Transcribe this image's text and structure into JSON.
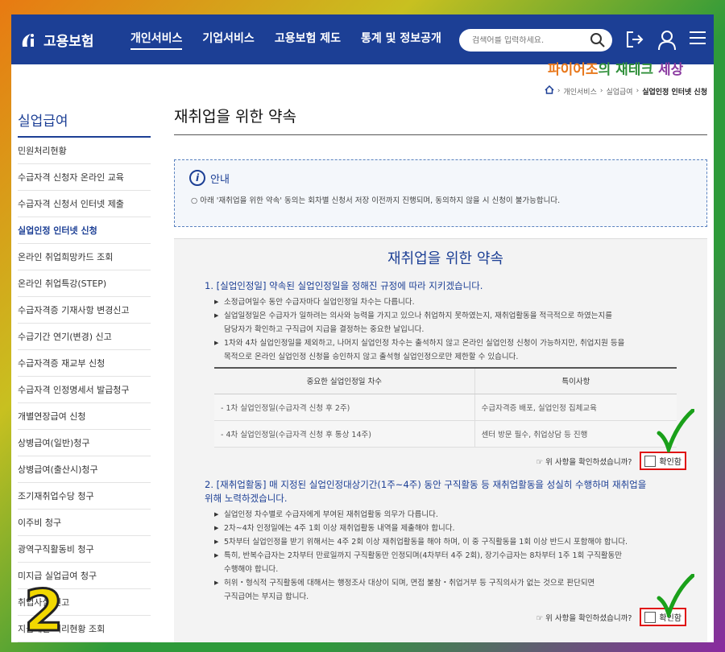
{
  "header": {
    "logo_text": "고용보험",
    "nav": [
      "개인서비스",
      "기업서비스",
      "고용보험 제도",
      "통계 및 정보공개"
    ],
    "search_placeholder": "검색어를 입력하세요."
  },
  "watermark": {
    "part1": "파이어조",
    "part2": "의 재테크",
    "part3": " 세상"
  },
  "breadcrumb": {
    "item1": "개인서비스",
    "item2": "실업급여",
    "current": "실업인정 인터넷 신청"
  },
  "sidebar": {
    "title": "실업급여",
    "items": [
      "민원처리현황",
      "수급자격 신청자 온라인 교육",
      "수급자격 신청서 인터넷 제출",
      "실업인정 인터넷 신청",
      "온라인 취업희망카드 조회",
      "온라인 취업특강(STEP)",
      "수급자격증 기재사항 변경신고",
      "수급기간 연기(변경) 신고",
      "수급자격증 재교부 신청",
      "수급자격 인정명세서 발급청구",
      "개별연장급여 신청",
      "상병급여(일반)청구",
      "상병급여(출산시)청구",
      "조기재취업수당 청구",
      "이주비 청구",
      "광역구직활동비 청구",
      "미지급 실업급여 청구",
      "취업사실 신고",
      "지급제한 처리현황 조회"
    ]
  },
  "main": {
    "page_title": "재취업을 위한 약속",
    "notice_title": "안내",
    "notice_text": "○ 아래 '재취업을 위한 약속' 동의는 회차별 신청서 저장 이전까지 진행되며, 동의하지 않을 시 신청이 불가능합니다.",
    "promise_title": "재취업을 위한 약속",
    "section1": {
      "heading": "1. [실업인정일] 약속된 실업인정일을 정해진 규정에 따라 지키겠습니다.",
      "b1": "소정급여일수 동안 수급자마다 실업인정일 차수는 다릅니다.",
      "b2_line1": "실업일정일은 수급자가 일하려는 의사와 능력을 가지고 있으나 취업하지 못하였는지, 재취업활동을 적극적으로 하였는지를",
      "b2_line2": "담당자가 확인하고 구직급여 지급을 결정하는 중요한 날입니다.",
      "b3_line1": "1차와 4차 실업인정일을 제외하고, 나머지 실업인정 차수는 출석하지 않고 온라인 실업인정 신청이 가능하지만, 취업지원 등을",
      "b3_line2": "목적으로 온라인 실업인정 신청을 승인하지 않고 출석형 실업인정으로만 제한할 수 있습니다.",
      "table_headers": [
        "중요한 실업인정일 차수",
        "특이사항"
      ],
      "table_rows": [
        [
          "- 1차 실업인정일(수급자격 신청 후 2주)",
          "수급자격증 배포, 실업인정 집체교육"
        ],
        [
          "- 4차 실업인정일(수급자격 신청 후 통상 14주)",
          "센터 방문 필수, 취업상담 등 진행"
        ]
      ],
      "confirm_q": "☞ 위 사항을 확인하셨습니까?",
      "confirm_label": "확인함"
    },
    "section2": {
      "heading_line1": "2. [재취업활동] 매 지정된 실업인정대상기간(1주~4주) 동안 구직활동 등 재취업활동을 성실히 수행하며 재취업을",
      "heading_line2": "위해 노력하겠습니다.",
      "b1": "실업인정 차수별로 수급자에게 부여된 재취업활동 의무가 다릅니다.",
      "b2": "2차~4차 인정일에는 4주 1회 이상 재취업활동 내역을 제출해야 합니다.",
      "b3": "5차부터 실업인정을 받기 위해서는 4주 2회 이상 재취업활동을 해야 하며, 이 중 구직활동을 1회 이상 반드시 포함해야 합니다.",
      "b4_line1": "특히, 반복수급자는 2차부터 만료일까지 구직활동만 인정되며(4차부터 4주 2회), 장기수급자는 8차부터 1주 1회 구직활동만",
      "b4_line2": "수행해야 합니다.",
      "b5_line1": "허위・형식적 구직활동에 대해서는 행정조사 대상이 되며, 면접 불참・취업거부 등 구직의사가 없는 것으로 판단되면",
      "b5_line2": "구직급여는 부지급 합니다.",
      "confirm_q": "☞ 위 사항을 확인하셨습니까?",
      "confirm_label": "확인함"
    }
  },
  "overlay_number": "2",
  "colors": {
    "brand": "#1c3f95",
    "highlight_border": "#e01010",
    "check": "#1aa01a",
    "overlay_number": "#f2d800"
  }
}
